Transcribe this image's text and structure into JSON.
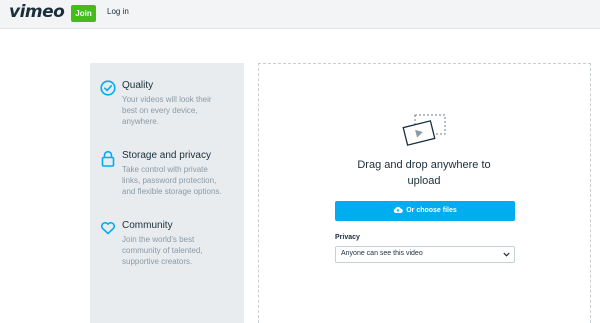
{
  "header": {
    "logo": "vimeo",
    "join_label": "Join",
    "login_label": "Log in"
  },
  "features": [
    {
      "icon": "check-circle-icon",
      "title": "Quality",
      "desc_lines": [
        "Your videos will look their",
        "best on every device,",
        "anywhere."
      ]
    },
    {
      "icon": "lock-icon",
      "title": "Storage and privacy",
      "desc_lines": [
        "Take control with private",
        "links, password protection,",
        "and flexible storage options."
      ]
    },
    {
      "icon": "heart-icon",
      "title": "Community",
      "desc_lines": [
        "Join the world's best",
        "community of talented,",
        "supportive creators."
      ]
    }
  ],
  "upload": {
    "icon": "video-file-icon",
    "drag_line1": "Drag and drop anywhere to",
    "drag_line2": "upload",
    "choose_label": "Or choose files",
    "choose_icon": "cloud-upload-icon",
    "privacy_label": "Privacy",
    "privacy_value": "Anyone can see this video"
  },
  "colors": {
    "brand_green": "#44bc1c",
    "accent_blue": "#00adef",
    "text_dark": "#1a2e3b",
    "text_muted": "#8c9aa6",
    "panel_bg": "#e8ecef"
  }
}
